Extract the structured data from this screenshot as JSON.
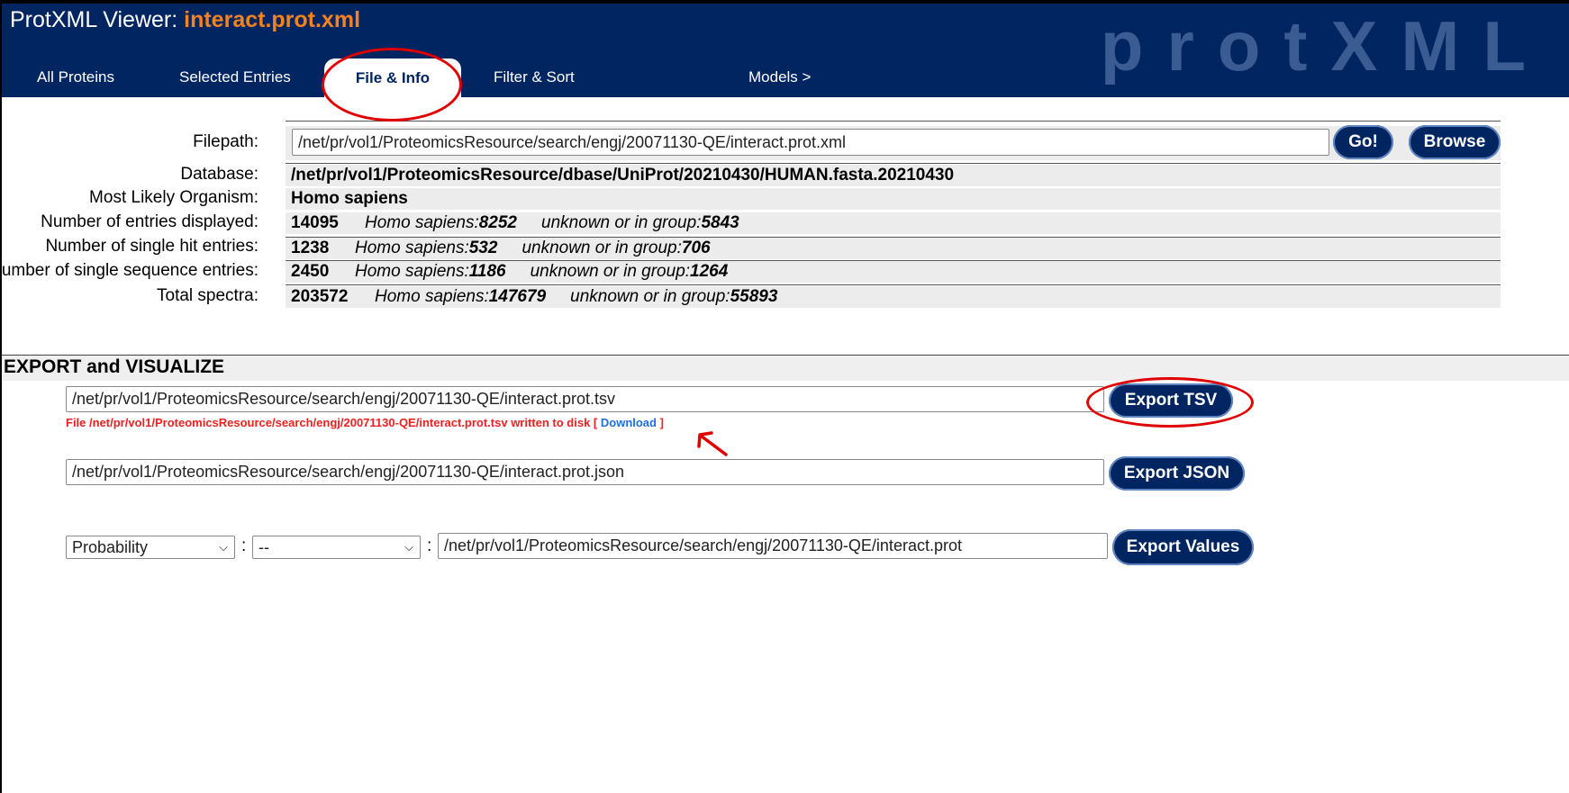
{
  "header": {
    "title_prefix": "ProtXML Viewer: ",
    "title_file": "interact.prot.xml",
    "brand": "protXML",
    "tabs": [
      "All Proteins",
      "Selected Entries",
      "File & Info",
      "Filter & Sort",
      "Models >"
    ],
    "active_tab": "File & Info"
  },
  "file_info": {
    "filepath_label": "Filepath:",
    "filepath_value": "/net/pr/vol1/ProteomicsResource/search/engj/20071130-QE/interact.prot.xml",
    "go_label": "Go!",
    "browse_label": "Browse",
    "database_label": "Database:",
    "database_value": "/net/pr/vol1/ProteomicsResource/dbase/UniProt/20210430/HUMAN.fasta.20210430",
    "organism_label": "Most Likely Organism:",
    "organism_value": "Homo sapiens",
    "rows": [
      {
        "label": "Number of entries displayed:",
        "total": "14095",
        "org_name": "Homo sapiens:",
        "org_count": "8252",
        "other_name": "unknown or in group:",
        "other_count": "5843"
      },
      {
        "label": "Number of single hit entries:",
        "total": "1238",
        "org_name": "Homo sapiens:",
        "org_count": "532",
        "other_name": "unknown or in group:",
        "other_count": "706"
      },
      {
        "label": "Number of single sequence entries:",
        "total": "2450",
        "org_name": "Homo sapiens:",
        "org_count": "1186",
        "other_name": "unknown or in group:",
        "other_count": "1264"
      },
      {
        "label": "Total spectra:",
        "total": "203572",
        "org_name": "Homo sapiens:",
        "org_count": "147679",
        "other_name": "unknown or in group:",
        "other_count": "55893"
      }
    ]
  },
  "export": {
    "heading": "EXPORT and VISUALIZE",
    "tsv_path": "/net/pr/vol1/ProteomicsResource/search/engj/20071130-QE/interact.prot.tsv",
    "tsv_button": "Export TSV",
    "message_prefix": "File /net/pr/vol1/ProteomicsResource/search/engj/20071130-QE/interact.prot.tsv written to disk [ ",
    "download_label": "Download",
    "message_suffix": " ]",
    "json_path": "/net/pr/vol1/ProteomicsResource/search/engj/20071130-QE/interact.prot.json",
    "json_button": "Export JSON",
    "values_select_1": "Probability",
    "values_select_2": "--",
    "colon": ":",
    "values_path": "/net/pr/vol1/ProteomicsResource/search/engj/20071130-QE/interact.prot",
    "values_button": "Export Values"
  },
  "annotations": {
    "highlight_color": "#e00000"
  },
  "colors": {
    "header_bg": "#002561",
    "title_file": "#f58220",
    "button_bg": "#002561",
    "message": "#f02020",
    "link": "#1e6fe0"
  }
}
